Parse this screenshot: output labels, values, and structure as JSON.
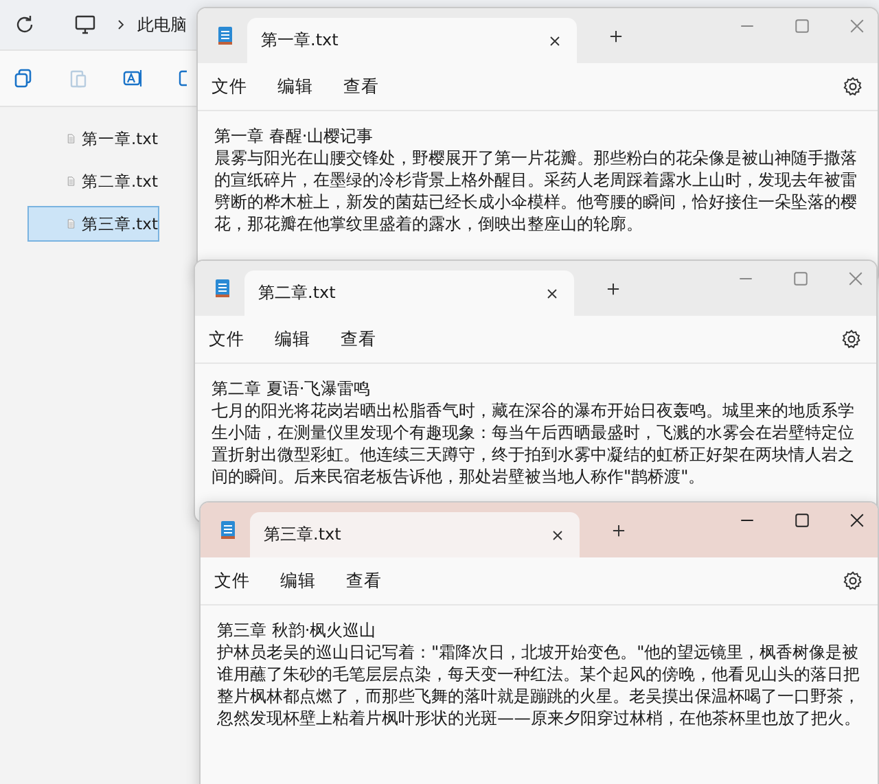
{
  "explorer": {
    "breadcrumb": "此电脑",
    "files": [
      {
        "name": "第一章.txt",
        "selected": false
      },
      {
        "name": "第二章.txt",
        "selected": false
      },
      {
        "name": "第三章.txt",
        "selected": true
      }
    ]
  },
  "windows": [
    {
      "tab_title": "第一章.txt",
      "active": false,
      "menu": [
        "文件",
        "编辑",
        "查看"
      ],
      "heading": "第一章 春醒·山樱记事",
      "body": "晨雾与阳光在山腰交锋处，野樱展开了第一片花瓣。那些粉白的花朵像是被山神随手撒落的宣纸碎片，在墨绿的冷杉背景上格外醒目。采药人老周踩着露水上山时，发现去年被雷劈断的桦木桩上，新发的菌菇已经长成小伞模样。他弯腰的瞬间，恰好接住一朵坠落的樱花，那花瓣在他掌纹里盛着的露水，倒映出整座山的轮廓。"
    },
    {
      "tab_title": "第二章.txt",
      "active": false,
      "menu": [
        "文件",
        "编辑",
        "查看"
      ],
      "heading": "第二章 夏语·飞瀑雷鸣",
      "body": "七月的阳光将花岗岩晒出松脂香气时，藏在深谷的瀑布开始日夜轰鸣。城里来的地质系学生小陆，在测量仪里发现个有趣现象：每当午后西晒最盛时，飞溅的水雾会在岩壁特定位置折射出微型彩虹。他连续三天蹲守，终于拍到水雾中凝结的虹桥正好架在两块情人岩之间的瞬间。后来民宿老板告诉他，那处岩壁被当地人称作\"鹊桥渡\"。"
    },
    {
      "tab_title": "第三章.txt",
      "active": true,
      "menu": [
        "文件",
        "编辑",
        "查看"
      ],
      "heading": "第三章 秋韵·枫火巡山",
      "body": "护林员老吴的巡山日记写着：\"霜降次日，北坡开始变色。\"他的望远镜里，枫香树像是被谁用蘸了朱砂的毛笔层层点染，每天变一种红法。某个起风的傍晚，他看见山头的落日把整片枫林都点燃了，而那些飞舞的落叶就是蹦跳的火星。老吴摸出保温杯喝了一口野茶，忽然发现杯壁上粘着片枫叶形状的光斑——原来夕阳穿过林梢，在他茶杯里也放了把火。"
    }
  ]
}
